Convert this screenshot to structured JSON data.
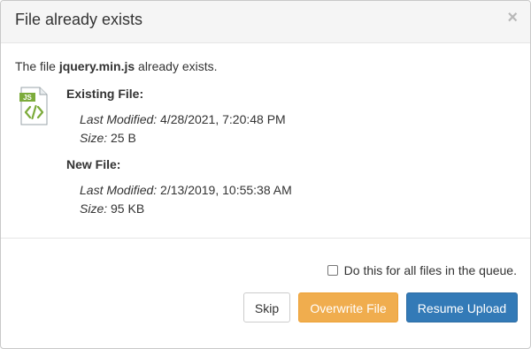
{
  "dialog": {
    "title": "File already exists",
    "close_glyph": "×",
    "close_icon": "close-icon"
  },
  "message": {
    "prefix": "The file ",
    "filename": "jquery.min.js",
    "suffix": " already exists."
  },
  "file_icon": {
    "name": "js-file-icon",
    "tag_text": "JS",
    "glyph": "</>",
    "accent": "#7cab3b"
  },
  "existing": {
    "heading": "Existing File:",
    "modified_label": "Last Modified:",
    "modified_value": " 4/28/2021, 7:20:48 PM",
    "size_label": "Size:",
    "size_value": " 25 B"
  },
  "new_file": {
    "heading": "New File:",
    "modified_label": "Last Modified:",
    "modified_value": " 2/13/2019, 10:55:38 AM",
    "size_label": "Size:",
    "size_value": " 95 KB"
  },
  "apply_all": {
    "label": "Do this for all files in the queue.",
    "checked": false
  },
  "buttons": {
    "skip": "Skip",
    "overwrite": "Overwrite File",
    "resume": "Resume Upload"
  },
  "colors": {
    "overwrite_bg": "#f0ad4e",
    "resume_bg": "#337ab7",
    "header_bg": "#f5f5f5"
  }
}
